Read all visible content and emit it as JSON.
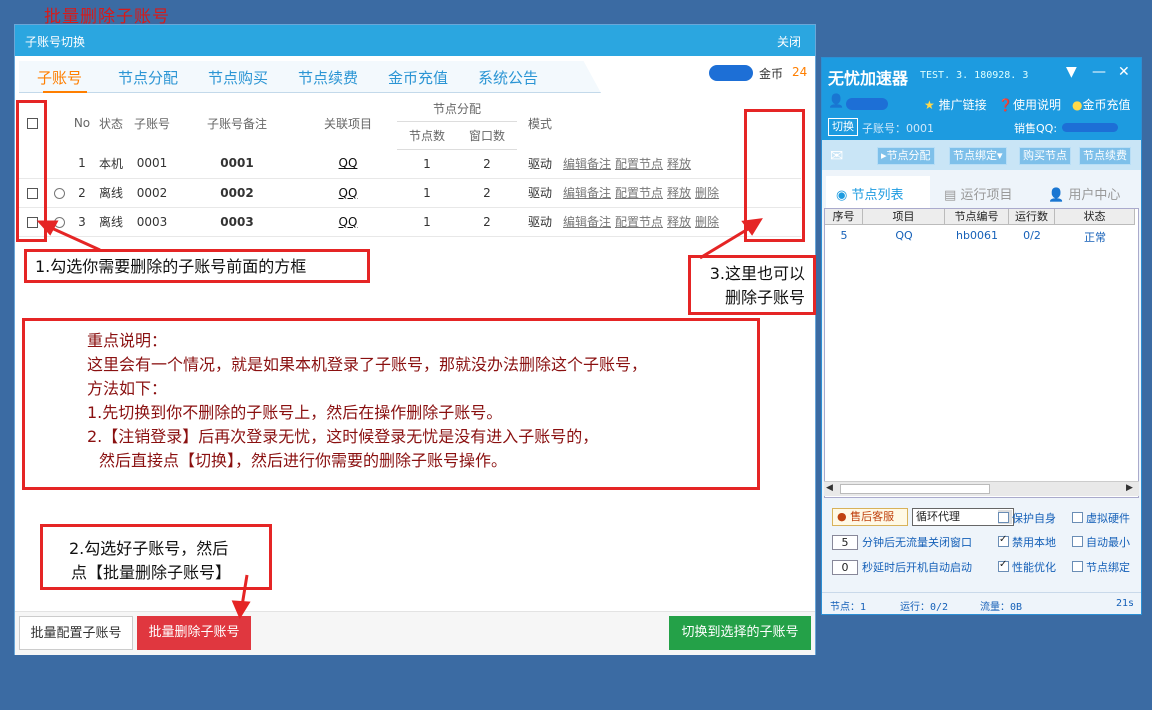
{
  "page_heading": "批量删除子账号",
  "dialog": {
    "title": "子账号切换",
    "close_label": "关闭",
    "tabs": [
      "子账号",
      "节点分配",
      "节点购买",
      "节点续费",
      "金币充值",
      "系统公告"
    ],
    "coins_label": "金币",
    "coins_value": "24",
    "table": {
      "headers": {
        "no": "No",
        "status": "状态",
        "account": "子账号",
        "remark": "子账号备注",
        "project": "关联项目",
        "node_alloc": "节点分配",
        "node_count": "节点数",
        "window_count": "窗口数",
        "mode": "模式"
      },
      "rows": [
        {
          "no": "1",
          "status": "本机",
          "account": "0001",
          "remark": "0001",
          "project": "QQ",
          "node_count": "1",
          "window_count": "2",
          "mode": "驱动",
          "ops": [
            "编辑备注",
            "配置节点",
            "释放"
          ]
        },
        {
          "no": "2",
          "status": "离线",
          "account": "0002",
          "remark": "0002",
          "project": "QQ",
          "node_count": "1",
          "window_count": "2",
          "mode": "驱动",
          "ops": [
            "编辑备注",
            "配置节点",
            "释放",
            "删除"
          ]
        },
        {
          "no": "3",
          "status": "离线",
          "account": "0003",
          "remark": "0003",
          "project": "QQ",
          "node_count": "1",
          "window_count": "2",
          "mode": "驱动",
          "ops": [
            "编辑备注",
            "配置节点",
            "释放",
            "删除"
          ]
        }
      ]
    },
    "footer": {
      "batch_config": "批量配置子账号",
      "batch_delete": "批量删除子账号",
      "switch": "切换到选择的子账号"
    }
  },
  "annotations": {
    "step1": "1.勾选你需要删除的子账号前面的方框",
    "step2_line1": "2.勾选好子账号，然后",
    "step2_line2": "点【批量删除子账号】",
    "step3_line1": "3.这里也可以",
    "step3_line2": "删除子账号",
    "important": {
      "title": "重点说明：",
      "line1": "这里会有一个情况，就是如果本机登录了子账号，那就没办法删除这个子账号，",
      "line2": "方法如下：",
      "line3": "1.先切换到你不删除的子账号上，然后在操作删除子账号。",
      "line4": "2.【注销登录】后再次登录无忧，这时候登录无忧是没有进入子账号的，",
      "line5": "然后直接点【切换】，然后进行你需要的删除子账号操作。"
    }
  },
  "client": {
    "app_name": "无忧加速器",
    "version": "TEST. 3. 180928. 3",
    "links": {
      "promo": "推广链接",
      "help": "使用说明",
      "recharge": "金币充值"
    },
    "switch_tag": "切换",
    "sub_account": "子账号：0001",
    "sales_qq": "销售QQ:",
    "toolbar": [
      "节点分配",
      "节点绑定",
      "购买节点",
      "节点续费"
    ],
    "tabs": [
      "节点列表",
      "运行项目",
      "用户中心"
    ],
    "list_headers": [
      "序号",
      "项目",
      "节点编号",
      "运行数",
      "状态"
    ],
    "list_rows": [
      [
        "5",
        "QQ",
        "hb0061",
        "0/2",
        "正常"
      ]
    ],
    "support": "售后客服",
    "proxy_mode": "循环代理",
    "options": {
      "protect": "保护自身",
      "virtual_hw": "虚拟硬件",
      "minutes_value": "5",
      "close_win": "分钟后无流量关闭窗口",
      "disable_local": "禁用本地",
      "auto_min": "自动最小",
      "delay_value": "0",
      "autostart": "秒延时后开机自动启动",
      "perf": "性能优化",
      "node_bind": "节点绑定"
    },
    "status": {
      "nodes": "节点：1",
      "running": "运行：0/2",
      "traffic": "流量：0B",
      "time": "21s"
    }
  }
}
